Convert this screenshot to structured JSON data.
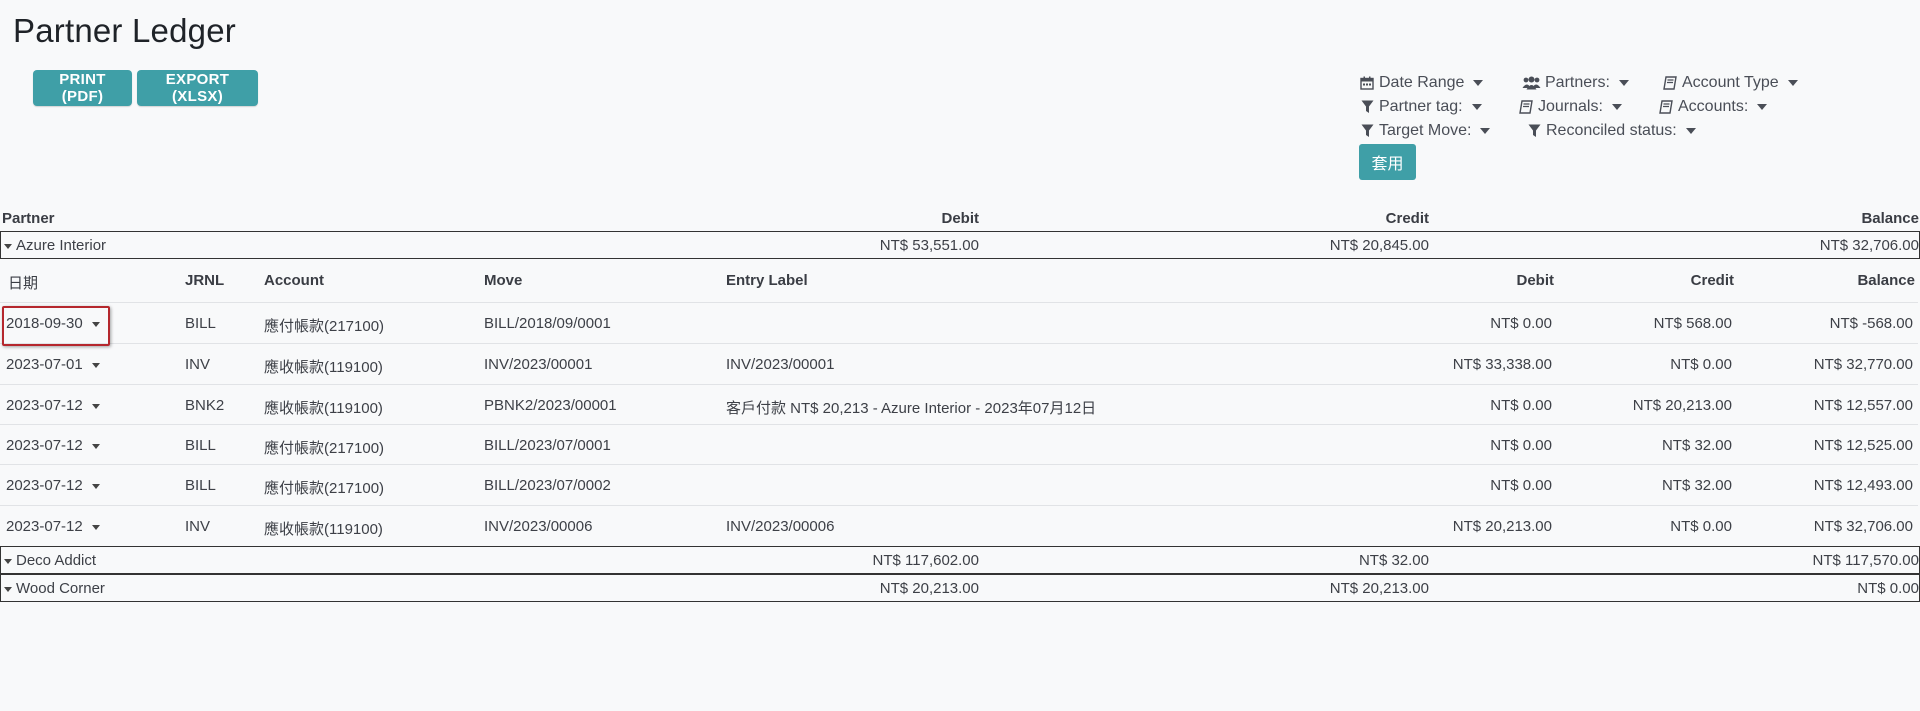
{
  "page": {
    "title": "Partner Ledger",
    "print_label": "PRINT (PDF)",
    "export_label": "EXPORT (XLSX)"
  },
  "filters": {
    "date_range": "Date Range",
    "partners": "Partners:",
    "account_type": "Account Type",
    "partner_tag": "Partner tag:",
    "journals": "Journals:",
    "accounts": "Accounts:",
    "target_move": "Target Move:",
    "reconciled_status": "Reconciled status:",
    "apply_label": "套用"
  },
  "icons": {
    "date_range": "calendar-icon",
    "partners": "users-icon",
    "account_type": "book-icon",
    "partner_tag": "filter-icon",
    "journals": "book-icon",
    "accounts": "book-icon",
    "target_move": "filter-icon",
    "reconciled_status": "filter-icon"
  },
  "colors": {
    "accent": "#3f9fa7",
    "highlight_border": "#b5272d",
    "background": "#f8f9fa"
  },
  "table": {
    "headers": {
      "partner": "Partner",
      "debit": "Debit",
      "credit": "Credit",
      "balance": "Balance"
    },
    "detail_headers": {
      "date": "日期",
      "journal": "JRNL",
      "account": "Account",
      "move": "Move",
      "label": "Entry Label",
      "debit": "Debit",
      "credit": "Credit",
      "balance": "Balance"
    },
    "partners": [
      {
        "name": "Azure Interior",
        "debit": "NT$ 53,551.00",
        "credit": "NT$ 20,845.00",
        "balance": "NT$ 32,706.00"
      },
      {
        "name": "Deco Addict",
        "debit": "NT$ 117,602.00",
        "credit": "NT$ 32.00",
        "balance": "NT$ 117,570.00"
      },
      {
        "name": "Wood Corner",
        "debit": "NT$ 20,213.00",
        "credit": "NT$ 20,213.00",
        "balance": "NT$ 0.00"
      }
    ],
    "lines": [
      {
        "date": "2018-09-30",
        "journal": "BILL",
        "account": "應付帳款(217100)",
        "move": "BILL/2018/09/0001",
        "label": "",
        "debit": "NT$ 0.00",
        "credit": "NT$ 568.00",
        "balance": "NT$ -568.00"
      },
      {
        "date": "2023-07-01",
        "journal": "INV",
        "account": "應收帳款(119100)",
        "move": "INV/2023/00001",
        "label": "INV/2023/00001",
        "debit": "NT$ 33,338.00",
        "credit": "NT$ 0.00",
        "balance": "NT$ 32,770.00"
      },
      {
        "date": "2023-07-12",
        "journal": "BNK2",
        "account": "應收帳款(119100)",
        "move": "PBNK2/2023/00001",
        "label": "客戶付款 NT$ 20,213 - Azure Interior - 2023年07月12日",
        "debit": "NT$ 0.00",
        "credit": "NT$ 20,213.00",
        "balance": "NT$ 12,557.00"
      },
      {
        "date": "2023-07-12",
        "journal": "BILL",
        "account": "應付帳款(217100)",
        "move": "BILL/2023/07/0001",
        "label": "",
        "debit": "NT$ 0.00",
        "credit": "NT$ 32.00",
        "balance": "NT$ 12,525.00"
      },
      {
        "date": "2023-07-12",
        "journal": "BILL",
        "account": "應付帳款(217100)",
        "move": "BILL/2023/07/0002",
        "label": "",
        "debit": "NT$ 0.00",
        "credit": "NT$ 32.00",
        "balance": "NT$ 12,493.00"
      },
      {
        "date": "2023-07-12",
        "journal": "INV",
        "account": "應收帳款(119100)",
        "move": "INV/2023/00006",
        "label": "INV/2023/00006",
        "debit": "NT$ 20,213.00",
        "credit": "NT$ 0.00",
        "balance": "NT$ 32,706.00"
      }
    ]
  }
}
